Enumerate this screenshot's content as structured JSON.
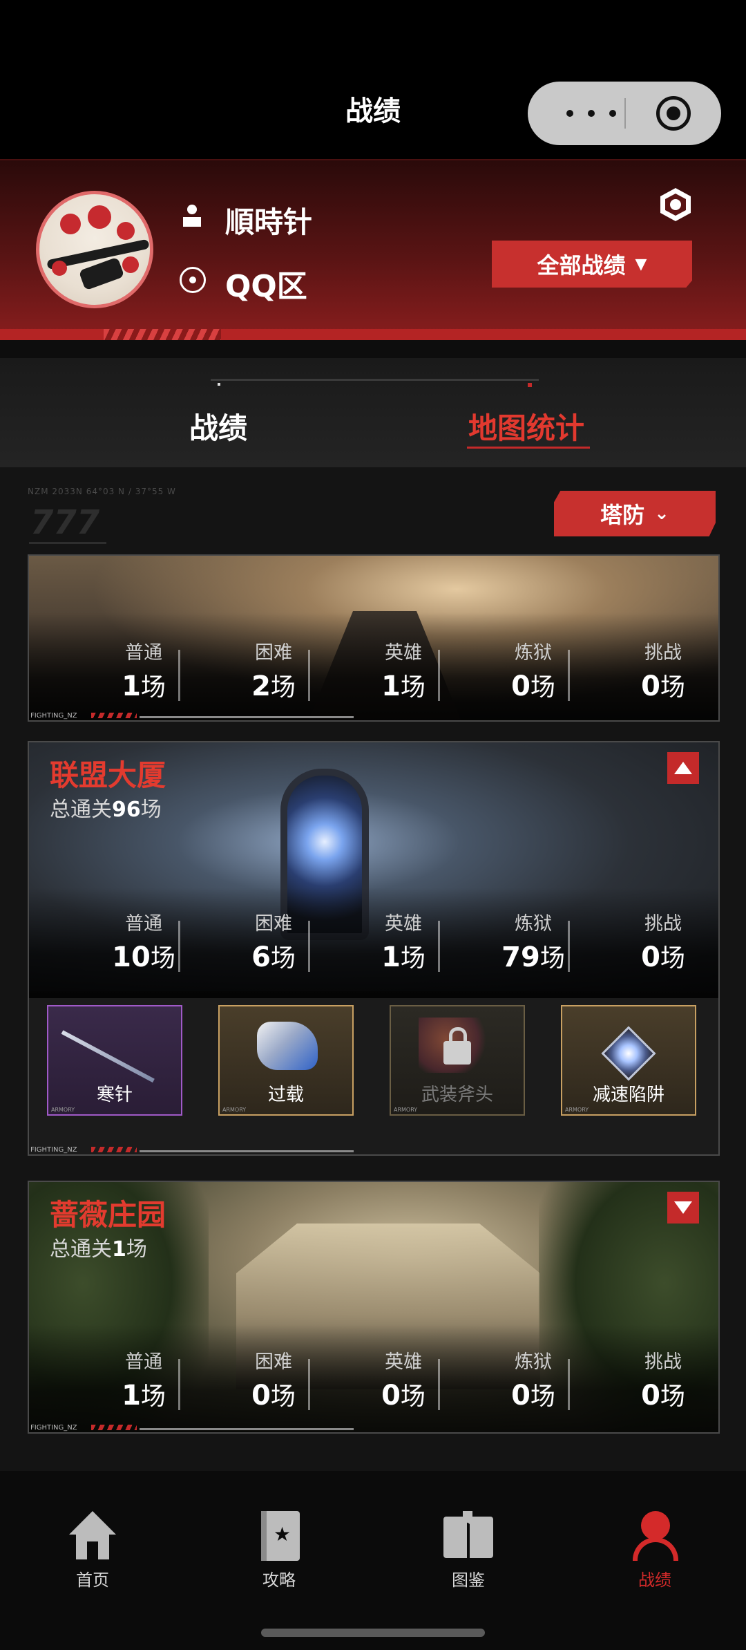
{
  "nav": {
    "title": "战绩"
  },
  "profile": {
    "username": "順時针",
    "server": "QQ区",
    "filter_label": "全部战绩",
    "filter_caret": "▼"
  },
  "tabs": [
    {
      "label": "战绩",
      "active": false
    },
    {
      "label": "地图统计",
      "active": true
    }
  ],
  "content": {
    "deco_text": "NZM 2033N 64°03 N / 37°55 W",
    "deco_marks": "777",
    "mode_label": "塔防",
    "mode_chevron": "⌄"
  },
  "difficulty_labels": [
    "普通",
    "困难",
    "英雄",
    "炼狱",
    "挑战"
  ],
  "unit": "场",
  "maps": [
    {
      "name": "",
      "total_prefix": "",
      "total": "",
      "expanded": false,
      "counts": [
        "1",
        "2",
        "1",
        "0",
        "0"
      ]
    },
    {
      "name": "联盟大厦",
      "total_prefix": "总通关",
      "total": "96",
      "total_unit": "场",
      "expanded": true,
      "counts": [
        "10",
        "6",
        "1",
        "79",
        "0"
      ],
      "rewards": [
        {
          "name": "寒针",
          "rarity": "purple",
          "locked": false,
          "icon": "sword-icon"
        },
        {
          "name": "过载",
          "rarity": "gold",
          "locked": false,
          "icon": "gun-icon"
        },
        {
          "name": "武装斧头",
          "rarity": "gold",
          "locked": true,
          "icon": "axe-icon"
        },
        {
          "name": "减速陷阱",
          "rarity": "gold",
          "locked": false,
          "icon": "trap-icon"
        }
      ]
    },
    {
      "name": "蔷薇庄园",
      "total_prefix": "总通关",
      "total": "1",
      "total_unit": "场",
      "expanded": false,
      "counts": [
        "1",
        "0",
        "0",
        "0",
        "0"
      ]
    }
  ],
  "card_tag": "FIGHTING_NZ",
  "reward_tag": "ARMORY",
  "tabbar": [
    {
      "label": "首页",
      "icon": "home-icon",
      "active": false
    },
    {
      "label": "攻略",
      "icon": "guide-icon",
      "active": false
    },
    {
      "label": "图鉴",
      "icon": "atlas-icon",
      "active": false
    },
    {
      "label": "战绩",
      "icon": "record-icon",
      "active": true
    }
  ],
  "colors": {
    "accent": "#c7302e",
    "active_tab": "#e2392f",
    "bg": "#141414"
  }
}
